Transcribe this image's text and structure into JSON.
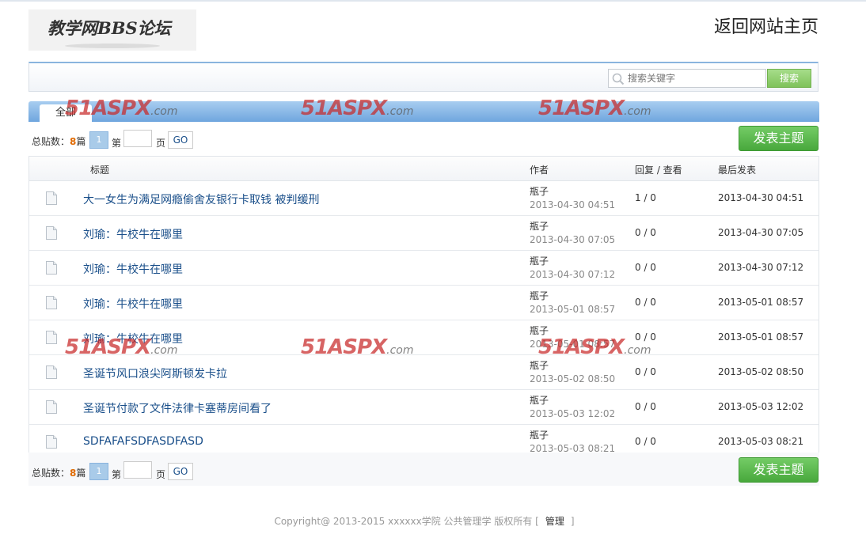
{
  "header": {
    "logo_text": "教学网BBS论坛",
    "home_link": "返回网站主页"
  },
  "search": {
    "placeholder": "搜索关键字",
    "button_label": "搜索"
  },
  "tabs": [
    {
      "label": "全部"
    }
  ],
  "watermark": {
    "brand": "51ASPX",
    "domain": ".com"
  },
  "pager": {
    "total_label": "总贴数：",
    "total_count": "8",
    "total_unit": "篇",
    "current_page": "1",
    "di_label": "第",
    "ye_label": "页",
    "go_label": "GO"
  },
  "post_button_label": "发表主题",
  "table": {
    "headers": {
      "title": "标题",
      "author": "作者",
      "stats": "回复 / 查看",
      "last": "最后发表"
    },
    "rows": [
      {
        "title": "大一女生为满足网瘾偷舍友银行卡取钱 被判缓刑",
        "author": "瓶子",
        "date": "2013-04-30 04:51",
        "stats": "1 / 0",
        "last": "2013-04-30 04:51"
      },
      {
        "title": "刘瑜：牛校牛在哪里",
        "author": "瓶子",
        "date": "2013-04-30 07:05",
        "stats": "0 / 0",
        "last": "2013-04-30 07:05"
      },
      {
        "title": "刘瑜：牛校牛在哪里",
        "author": "瓶子",
        "date": "2013-04-30 07:12",
        "stats": "0 / 0",
        "last": "2013-04-30 07:12"
      },
      {
        "title": "刘瑜：牛校牛在哪里",
        "author": "瓶子",
        "date": "2013-05-01 08:57",
        "stats": "0 / 0",
        "last": "2013-05-01 08:57"
      },
      {
        "title": "刘瑜：牛校牛在哪里",
        "author": "瓶子",
        "date": "2013-05-01 08:57",
        "stats": "0 / 0",
        "last": "2013-05-01 08:57"
      },
      {
        "title": "圣诞节风口浪尖阿斯顿发卡拉",
        "author": "瓶子",
        "date": "2013-05-02 08:50",
        "stats": "0 / 0",
        "last": "2013-05-02 08:50"
      },
      {
        "title": "圣诞节付款了文件法律卡塞蒂房间看了",
        "author": "瓶子",
        "date": "2013-05-03 12:02",
        "stats": "0 / 0",
        "last": "2013-05-03 12:02"
      },
      {
        "title": "SDFAFAFSDFASDFASD",
        "author": "瓶子",
        "date": "2013-05-03 08:21",
        "stats": "0 / 0",
        "last": "2013-05-03 08:21"
      }
    ]
  },
  "footer": {
    "copyright": "Copyright@ 2013-2015 xxxxxx学院  公共管理学  版权所有 [",
    "admin_label": "管理",
    "close_bracket": "]"
  },
  "colors": {
    "link": "#1a4f8a",
    "accent_green": "#48a83c",
    "tab_blue": "#6fa6de",
    "count_orange": "#e06a00"
  }
}
